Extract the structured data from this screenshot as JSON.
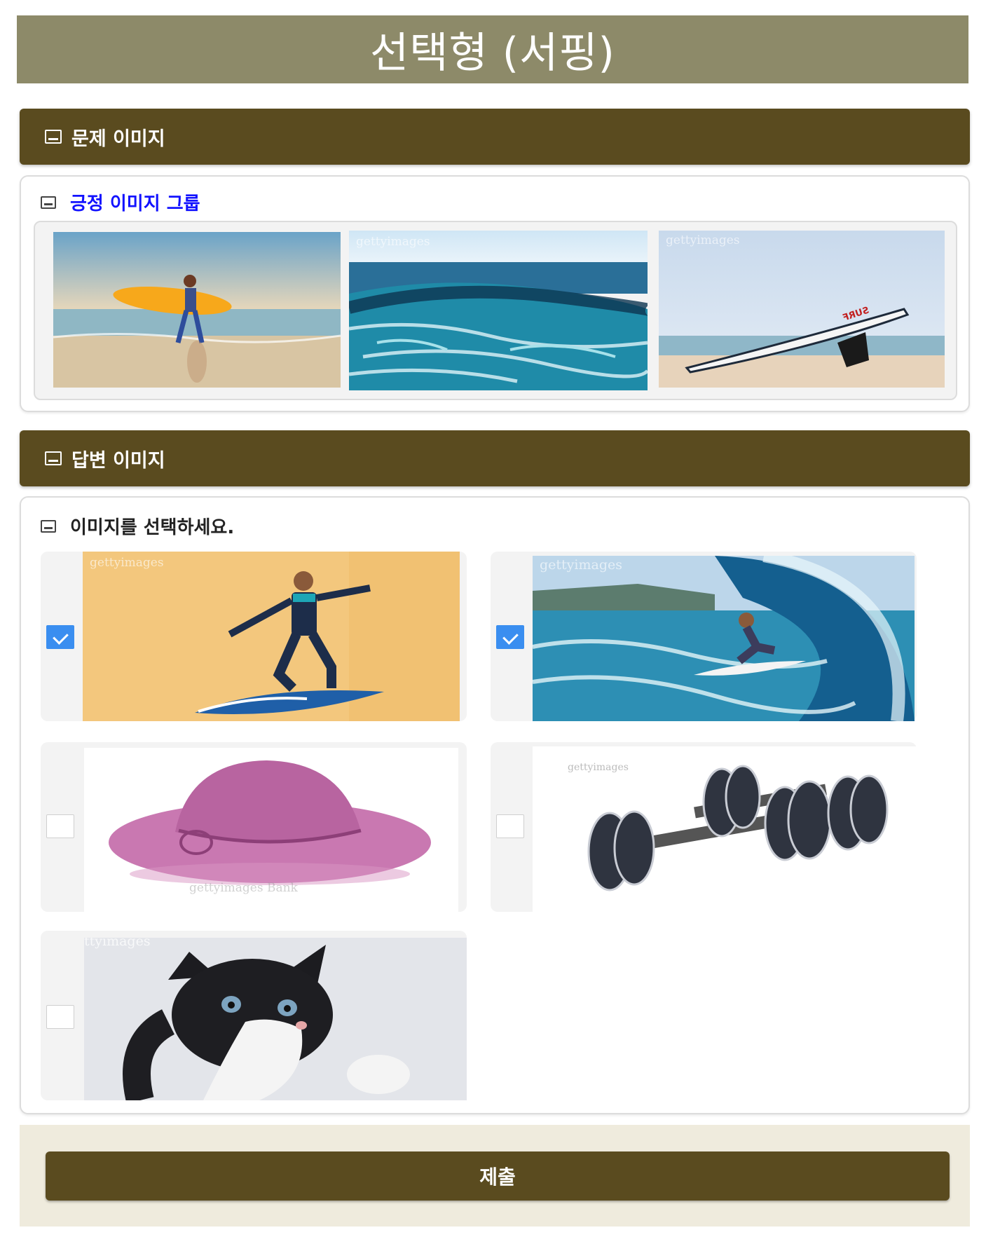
{
  "page": {
    "title": "선택형 (서핑)"
  },
  "question_section": {
    "header": "문제 이미지",
    "icon": "image-icon",
    "group_label": "긍정 이미지 그룹",
    "group_label_color": "#1212ff",
    "images": [
      {
        "name": "woman-carrying-surfboard-photo"
      },
      {
        "name": "ocean-waves-photo",
        "watermark": "gettyimages"
      },
      {
        "name": "surfboard-on-beach-photo",
        "watermark": "gettyimages",
        "board_text": "SURF"
      }
    ]
  },
  "answer_section": {
    "header": "답변 이미지",
    "icon": "image-icon",
    "instruction": "이미지를 선택하세요.",
    "options": [
      {
        "name": "man-on-surfboard-photo",
        "checked": true,
        "watermark": "gettyimages"
      },
      {
        "name": "surfer-in-wave-photo",
        "checked": true,
        "watermark": "gettyimages"
      },
      {
        "name": "pink-hat-photo",
        "checked": false,
        "watermark": "gettyimages Bank"
      },
      {
        "name": "dumbbells-photo",
        "checked": false,
        "watermark": "gettyimages"
      },
      {
        "name": "kitten-photo",
        "checked": false,
        "watermark": "ttyimages"
      }
    ]
  },
  "footer": {
    "submit_label": "제출"
  },
  "colors": {
    "title_bar": "#8d8a69",
    "section_header": "#5a4b1f",
    "footer_bg": "#efebdd",
    "checkbox_checked": "#3a8ef0"
  }
}
